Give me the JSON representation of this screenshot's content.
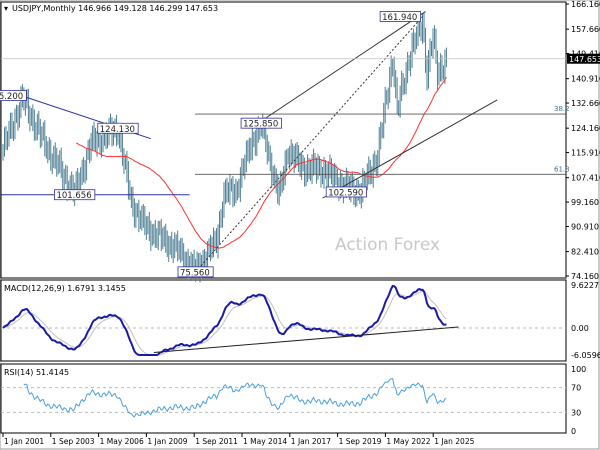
{
  "header": {
    "symbol": "USDJPY,Monthly",
    "ohlc": "146.966 149.128 146.299 147.653"
  },
  "watermark": "Action Forex",
  "colors": {
    "bars": "#4f7f94",
    "ma": "#ff3030",
    "trend": "#3030a0",
    "macd": "#1a1aa8",
    "signal": "#c0c0c0",
    "rsi": "#4aa0e0",
    "fib": "#333333"
  },
  "price_axis": {
    "min": 74.16,
    "max": 166.16,
    "ticks": [
      "166.160",
      "157.660",
      "149.410",
      "140.910",
      "132.660",
      "124.160",
      "115.910",
      "107.410",
      "99.160",
      "90.910",
      "82.410",
      "74.160"
    ],
    "current": "147.653"
  },
  "time_axis": {
    "ticks": [
      "1 Jan 2001",
      "1 Sep 2003",
      "1 May 2006",
      "1 Jan 2009",
      "1 Sep 2011",
      "1 May 2014",
      "1 Jan 2017",
      "1 Sep 2019",
      "1 May 2022",
      "1 Jan 2025"
    ]
  },
  "price_path": [
    [
      "2001-01",
      117
    ],
    [
      "2002-02",
      134
    ],
    [
      "2003-06",
      118
    ],
    [
      "2004-06",
      108
    ],
    [
      "2005-01",
      102
    ],
    [
      "2005-12",
      119
    ],
    [
      "2007-06",
      124
    ],
    [
      "2008-03",
      99
    ],
    [
      "2008-12",
      91
    ],
    [
      "2009-11",
      87
    ],
    [
      "2010-08",
      84
    ],
    [
      "2011-10",
      76
    ],
    [
      "2012-12",
      86
    ],
    [
      "2013-05",
      102
    ],
    [
      "2014-01",
      103
    ],
    [
      "2014-12",
      120
    ],
    [
      "2015-06",
      125
    ],
    [
      "2016-06",
      101
    ],
    [
      "2016-12",
      117
    ],
    [
      "2017-09",
      111
    ],
    [
      "2018-12",
      110
    ],
    [
      "2020-03",
      104
    ],
    [
      "2021-01",
      103
    ],
    [
      "2021-12",
      115
    ],
    [
      "2022-10",
      148
    ],
    [
      "2023-01",
      130
    ],
    [
      "2023-10",
      150
    ],
    [
      "2024-06",
      160
    ],
    [
      "2024-09",
      143
    ],
    [
      "2025-01",
      155
    ],
    [
      "2025-04",
      143
    ],
    [
      "2025-10",
      147.65
    ]
  ],
  "labels": [
    {
      "text": "135.200",
      "date": "2002-02",
      "price": 135.2
    },
    {
      "text": "124.130",
      "date": "2007-06",
      "price": 124.13
    },
    {
      "text": "101.656",
      "date": "2005-01",
      "price": 101.656
    },
    {
      "text": "75.560",
      "date": "2011-10",
      "price": 75.56
    },
    {
      "text": "125.850",
      "date": "2015-06",
      "price": 125.85
    },
    {
      "text": "102.590",
      "date": "2020-03",
      "price": 102.59
    },
    {
      "text": "161.940",
      "date": "2024-06",
      "price": 161.94
    }
  ],
  "fib": [
    {
      "text": "38.2",
      "price": 128.94
    },
    {
      "text": "61.8",
      "price": 108.56
    }
  ],
  "macd": {
    "title": "MACD(12,26,9) 1.6791 3.1455",
    "ticks": [
      "9.6227",
      "0.00",
      "-6.0596"
    ],
    "min": -6.0596,
    "max": 9.6227
  },
  "rsi": {
    "title": "RSI(14) 51.4145",
    "ticks": [
      "100",
      "70",
      "30",
      "0"
    ]
  }
}
